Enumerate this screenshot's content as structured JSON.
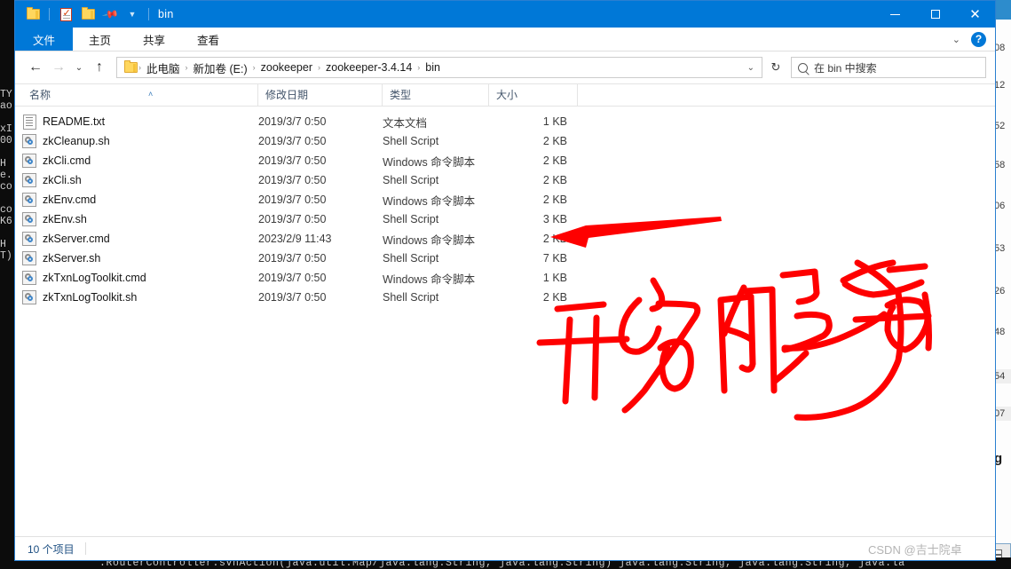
{
  "window": {
    "title": "bin",
    "quick_access": [
      {
        "name": "folder-icon",
        "label": "文件夹"
      },
      {
        "name": "properties-icon",
        "label": "属性"
      },
      {
        "name": "new-folder-icon",
        "label": "新建文件夹"
      },
      {
        "name": "pin-icon",
        "label": "固定"
      },
      {
        "name": "customize-caret-icon",
        "label": "自定义快速访问工具栏"
      }
    ],
    "controls": {
      "minimize": "—",
      "maximize": "□",
      "close": "✕"
    }
  },
  "ribbon": {
    "tabs": [
      {
        "label": "文件",
        "active": true
      },
      {
        "label": "主页",
        "active": false
      },
      {
        "label": "共享",
        "active": false
      },
      {
        "label": "查看",
        "active": false
      }
    ],
    "collapse_icon": "⌄",
    "help_label": "?"
  },
  "navigation": {
    "back_icon": "←",
    "forward_icon": "→",
    "history_icon": "⌄",
    "up_icon": "↑",
    "refresh_icon": "↻"
  },
  "breadcrumb": {
    "separator": "›",
    "items": [
      "此电脑",
      "新加卷 (E:)",
      "zookeeper",
      "zookeeper-3.4.14",
      "bin"
    ],
    "dropdown_icon": "⌄"
  },
  "search": {
    "placeholder": "在 bin 中搜索",
    "icon": "search-icon"
  },
  "columns": [
    {
      "key": "name",
      "label": "名称"
    },
    {
      "key": "date",
      "label": "修改日期"
    },
    {
      "key": "type",
      "label": "类型"
    },
    {
      "key": "size",
      "label": "大小"
    }
  ],
  "sort_indicator": "˄",
  "files": [
    {
      "name": "README.txt",
      "date": "2019/3/7 0:50",
      "type": "文本文档",
      "size": "1 KB",
      "icon": "doc"
    },
    {
      "name": "zkCleanup.sh",
      "date": "2019/3/7 0:50",
      "type": "Shell Script",
      "size": "2 KB",
      "icon": "script"
    },
    {
      "name": "zkCli.cmd",
      "date": "2019/3/7 0:50",
      "type": "Windows 命令脚本",
      "size": "2 KB",
      "icon": "script"
    },
    {
      "name": "zkCli.sh",
      "date": "2019/3/7 0:50",
      "type": "Shell Script",
      "size": "2 KB",
      "icon": "script"
    },
    {
      "name": "zkEnv.cmd",
      "date": "2019/3/7 0:50",
      "type": "Windows 命令脚本",
      "size": "2 KB",
      "icon": "script"
    },
    {
      "name": "zkEnv.sh",
      "date": "2019/3/7 0:50",
      "type": "Shell Script",
      "size": "3 KB",
      "icon": "script"
    },
    {
      "name": "zkServer.cmd",
      "date": "2023/2/9 11:43",
      "type": "Windows 命令脚本",
      "size": "2 KB",
      "icon": "script"
    },
    {
      "name": "zkServer.sh",
      "date": "2019/3/7 0:50",
      "type": "Shell Script",
      "size": "7 KB",
      "icon": "script"
    },
    {
      "name": "zkTxnLogToolkit.cmd",
      "date": "2019/3/7 0:50",
      "type": "Windows 命令脚本",
      "size": "1 KB",
      "icon": "script"
    },
    {
      "name": "zkTxnLogToolkit.sh",
      "date": "2019/3/7 0:50",
      "type": "Shell Script",
      "size": "2 KB",
      "icon": "script"
    }
  ],
  "status": {
    "count_text": "10 个项目"
  },
  "annotations": {
    "arrow_color": "#fe0000",
    "handwriting_color": "#fe0000",
    "handwriting_text": "开始服务",
    "arrow_target_row": "zkServer.cmd"
  },
  "watermark": {
    "text": "CSDN @吉士院卓"
  },
  "background": {
    "console_bottom_text": ".RouterController.svnAction(java.util.Map/java.lang.String, java.lang.String) java.lang.String, java.lang.String, java.la",
    "console_left_text": "TY\nao\n\nxI\n00\n\nH\ne.\nco\n\nco\nK6\n\nH\nT)",
    "right_window_lines": [
      "08",
      "12",
      "52",
      "58",
      "06",
      "53",
      "26",
      "48",
      "54",
      "07"
    ],
    "right_window_mark": "g"
  },
  "colors": {
    "accent": "#0078d7",
    "annotation": "#fe0000",
    "column_header_text": "#43556b",
    "status_text": "#1d4f82"
  }
}
